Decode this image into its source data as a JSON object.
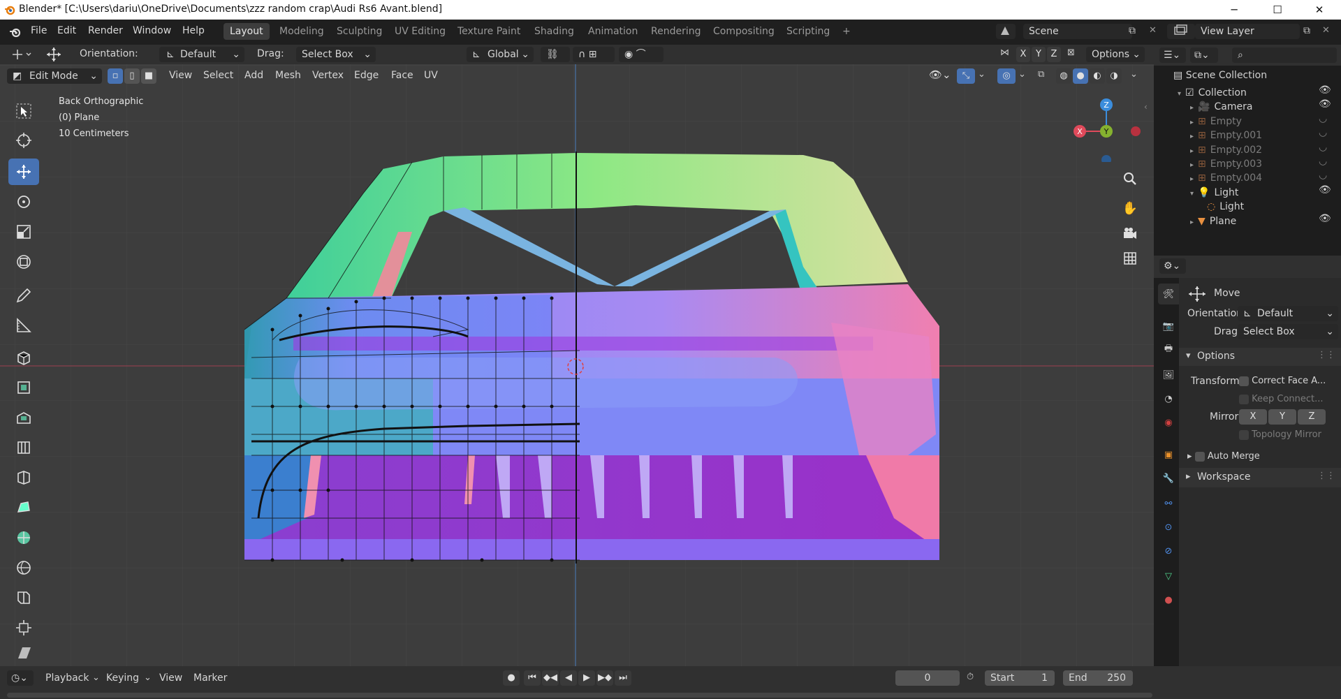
{
  "window": {
    "title": "Blender* [C:\\Users\\dariu\\OneDrive\\Documents\\zzz random crap\\Audi Rs6 Avant.blend]",
    "minimize": "─",
    "maximize": "☐",
    "close": "✕"
  },
  "menus": [
    "File",
    "Edit",
    "Render",
    "Window",
    "Help"
  ],
  "workspaces": [
    "Layout",
    "Modeling",
    "Sculpting",
    "UV Editing",
    "Texture Paint",
    "Shading",
    "Animation",
    "Rendering",
    "Compositing",
    "Scripting",
    "+"
  ],
  "scene": {
    "name": "Scene",
    "view_layer": "View Layer"
  },
  "tool_header": {
    "orientation_label": "Orientation:",
    "orientation_value": "Default",
    "drag_label": "Drag:",
    "drag_value": "Select Box",
    "transform_space": "Global",
    "axes": [
      "X",
      "Y",
      "Z"
    ],
    "options": "Options"
  },
  "view_header": {
    "mode": "Edit Mode",
    "menus": [
      "View",
      "Select",
      "Add",
      "Mesh",
      "Vertex",
      "Edge",
      "Face",
      "UV"
    ]
  },
  "viewport": {
    "info_lines": [
      "Back Orthographic",
      "(0) Plane",
      "10 Centimeters"
    ],
    "gizmo": {
      "x": "X",
      "y": "Y",
      "z": "Z"
    }
  },
  "outliner": {
    "title": "Scene Collection",
    "items": [
      {
        "name": "Collection",
        "depth": 1,
        "dim": false
      },
      {
        "name": "Camera",
        "depth": 2,
        "dim": false
      },
      {
        "name": "Empty",
        "depth": 2,
        "dim": true
      },
      {
        "name": "Empty.001",
        "depth": 2,
        "dim": true
      },
      {
        "name": "Empty.002",
        "depth": 2,
        "dim": true
      },
      {
        "name": "Empty.003",
        "depth": 2,
        "dim": true
      },
      {
        "name": "Empty.004",
        "depth": 2,
        "dim": true
      },
      {
        "name": "Light",
        "depth": 2,
        "dim": false
      },
      {
        "name": "Light",
        "depth": 3,
        "dim": false
      },
      {
        "name": "Plane",
        "depth": 2,
        "dim": false
      }
    ]
  },
  "properties": {
    "tool_name": "Move",
    "orientation_label": "Orientation",
    "orientation_value": "Default",
    "drag_label": "Drag:",
    "drag_value": "Select Box",
    "options_header": "Options",
    "transform_label": "Transform",
    "correct_face": "Correct Face A...",
    "keep_connected": "Keep Connect...",
    "mirror_label": "Mirror",
    "mirror_axes": [
      "X",
      "Y",
      "Z"
    ],
    "topology_mirror": "Topology Mirror",
    "auto_merge": "Auto Merge",
    "workspace_header": "Workspace"
  },
  "timeline": {
    "menus": [
      "Playback",
      "Keying",
      "View",
      "Marker"
    ],
    "current_frame": "0",
    "start_label": "Start",
    "start_value": "1",
    "end_label": "End",
    "end_value": "250"
  },
  "colors": {
    "accent": "#4772b3",
    "axis_x": "#e04a5b",
    "axis_y": "#85b22f",
    "axis_z": "#3b8ddc",
    "header": "#303030",
    "panel": "#1d1d1d"
  }
}
